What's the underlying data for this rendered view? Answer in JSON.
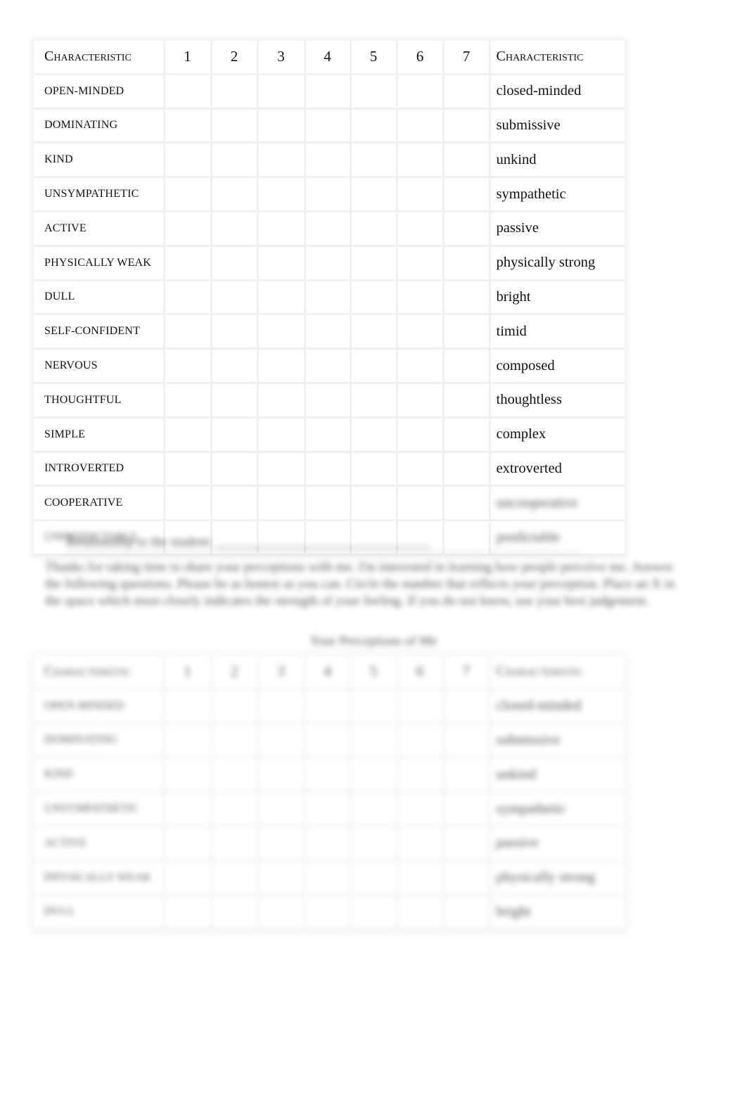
{
  "table1": {
    "header": {
      "left": "Characteristic",
      "scale": [
        "1",
        "2",
        "3",
        "4",
        "5",
        "6",
        "7"
      ],
      "right": "Characteristic"
    },
    "rows": [
      {
        "left": "open-minded",
        "right": "closed-minded"
      },
      {
        "left": "dominating",
        "right": "submissive"
      },
      {
        "left": "kind",
        "right": "unkind"
      },
      {
        "left": "unsympathetic",
        "right": "sympathetic"
      },
      {
        "left": "active",
        "right": "passive"
      },
      {
        "left": "physically weak",
        "right": "physically strong"
      },
      {
        "left": "dull",
        "right": "bright"
      },
      {
        "left": "self-confident",
        "right": "timid"
      },
      {
        "left": "nervous",
        "right": "composed"
      },
      {
        "left": "thoughtful",
        "right": "thoughtless"
      },
      {
        "left": "simple",
        "right": "complex"
      },
      {
        "left": "introverted",
        "right": "extroverted"
      },
      {
        "left": "cooperative",
        "right": "uncooperative"
      },
      {
        "left": "unpredictable",
        "right": "predictable"
      }
    ]
  },
  "blurred": {
    "relationship_line": "Relationship to the student: ________________________________",
    "instructions": "Thanks for taking time to share your perceptions with me. I'm interested in learning how people perceive me. Answer the following questions. Please be as honest as you can. Circle the number that reflects your perception. Place an X in the space which most closely indicates the strength of your feeling. If you do not know, use your best judgement.",
    "caption": "Your Perceptions of Me"
  },
  "table2": {
    "header": {
      "left": "Characteristic",
      "scale": [
        "1",
        "2",
        "3",
        "4",
        "5",
        "6",
        "7"
      ],
      "right": "Characteristic"
    },
    "rows": [
      {
        "left": "open-minded",
        "right": "closed-minded"
      },
      {
        "left": "dominating",
        "right": "submissive"
      },
      {
        "left": "kind",
        "right": "unkind"
      },
      {
        "left": "unsympathetic",
        "right": "sympathetic"
      },
      {
        "left": "active",
        "right": "passive"
      },
      {
        "left": "physically weak",
        "right": "physically strong"
      },
      {
        "left": "dull",
        "right": "bright"
      }
    ]
  }
}
